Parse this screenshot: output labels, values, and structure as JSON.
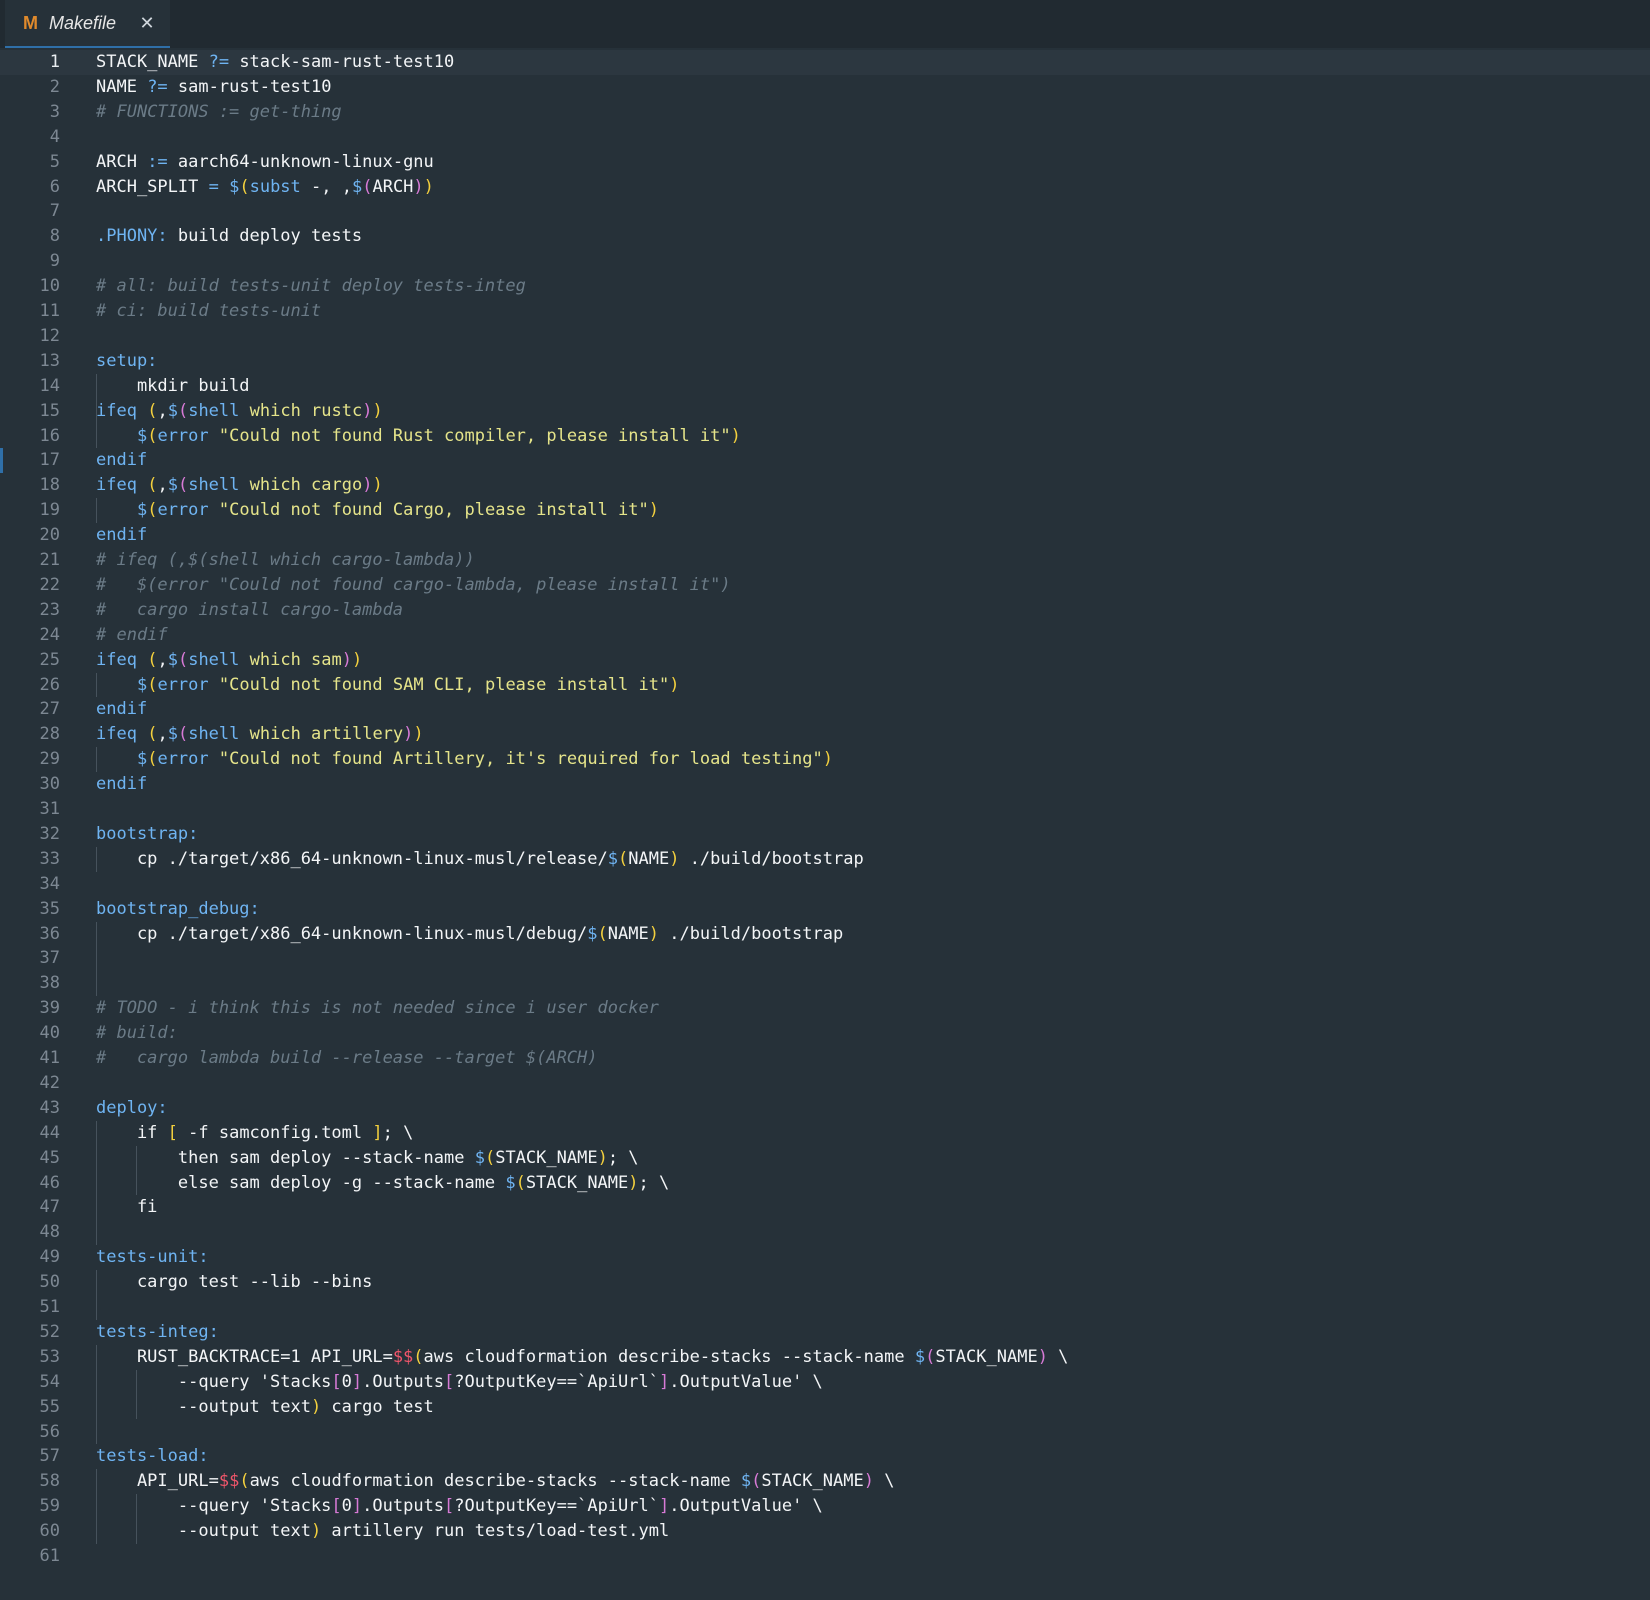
{
  "tab": {
    "icon": "M",
    "title": "Makefile",
    "close": "✕"
  },
  "current_line": 1,
  "lines": [
    [
      [
        "w",
        "STACK_NAME "
      ],
      [
        "k",
        "?="
      ],
      [
        "w",
        " stack-sam-rust-test10"
      ]
    ],
    [
      [
        "w",
        "NAME "
      ],
      [
        "k",
        "?="
      ],
      [
        "w",
        " sam-rust-test10"
      ]
    ],
    [
      [
        "c",
        "# FUNCTIONS := get-thing"
      ]
    ],
    [],
    [
      [
        "w",
        "ARCH "
      ],
      [
        "k",
        ":="
      ],
      [
        "w",
        " aarch64-unknown-linux-gnu"
      ]
    ],
    [
      [
        "w",
        "ARCH_SPLIT "
      ],
      [
        "k",
        "="
      ],
      [
        "w",
        " "
      ],
      [
        "k",
        "$"
      ],
      [
        "p1",
        "("
      ],
      [
        "f",
        "subst"
      ],
      [
        "w",
        " -, ,"
      ],
      [
        "k",
        "$"
      ],
      [
        "p2",
        "("
      ],
      [
        "w",
        "ARCH"
      ],
      [
        "p2",
        ")"
      ],
      [
        "p1",
        ")"
      ]
    ],
    [],
    [
      [
        "k",
        ".PHONY:"
      ],
      [
        "w",
        " build deploy tests"
      ]
    ],
    [],
    [
      [
        "c",
        "# all: build tests-unit deploy tests-integ"
      ]
    ],
    [
      [
        "c",
        "# ci: build tests-unit"
      ]
    ],
    [],
    [
      [
        "k",
        "setup:"
      ]
    ],
    [
      [
        "w",
        "    mkdir build"
      ]
    ],
    [
      [
        "k",
        "ifeq"
      ],
      [
        "w",
        " "
      ],
      [
        "p1",
        "("
      ],
      [
        "w",
        ","
      ],
      [
        "k",
        "$"
      ],
      [
        "p2",
        "("
      ],
      [
        "f",
        "shell"
      ],
      [
        "s",
        " which rustc"
      ],
      [
        "p2",
        ")"
      ],
      [
        "p1",
        ")"
      ]
    ],
    [
      [
        "w",
        "    "
      ],
      [
        "k",
        "$"
      ],
      [
        "p1",
        "("
      ],
      [
        "f",
        "error"
      ],
      [
        "s",
        " \"Could not found Rust compiler, please install it\""
      ],
      [
        "p1",
        ")"
      ]
    ],
    [
      [
        "k",
        "endif"
      ]
    ],
    [
      [
        "k",
        "ifeq"
      ],
      [
        "w",
        " "
      ],
      [
        "p1",
        "("
      ],
      [
        "w",
        ","
      ],
      [
        "k",
        "$"
      ],
      [
        "p2",
        "("
      ],
      [
        "f",
        "shell"
      ],
      [
        "s",
        " which cargo"
      ],
      [
        "p2",
        ")"
      ],
      [
        "p1",
        ")"
      ]
    ],
    [
      [
        "w",
        "    "
      ],
      [
        "k",
        "$"
      ],
      [
        "p1",
        "("
      ],
      [
        "f",
        "error"
      ],
      [
        "s",
        " \"Could not found Cargo, please install it\""
      ],
      [
        "p1",
        ")"
      ]
    ],
    [
      [
        "k",
        "endif"
      ]
    ],
    [
      [
        "c",
        "# ifeq (,$(shell which cargo-lambda))"
      ]
    ],
    [
      [
        "c",
        "#   $(error \"Could not found cargo-lambda, please install it\")"
      ]
    ],
    [
      [
        "c",
        "#   cargo install cargo-lambda"
      ]
    ],
    [
      [
        "c",
        "# endif"
      ]
    ],
    [
      [
        "k",
        "ifeq"
      ],
      [
        "w",
        " "
      ],
      [
        "p1",
        "("
      ],
      [
        "w",
        ","
      ],
      [
        "k",
        "$"
      ],
      [
        "p2",
        "("
      ],
      [
        "f",
        "shell"
      ],
      [
        "s",
        " which sam"
      ],
      [
        "p2",
        ")"
      ],
      [
        "p1",
        ")"
      ]
    ],
    [
      [
        "w",
        "    "
      ],
      [
        "k",
        "$"
      ],
      [
        "p1",
        "("
      ],
      [
        "f",
        "error"
      ],
      [
        "s",
        " \"Could not found SAM CLI, please install it\""
      ],
      [
        "p1",
        ")"
      ]
    ],
    [
      [
        "k",
        "endif"
      ]
    ],
    [
      [
        "k",
        "ifeq"
      ],
      [
        "w",
        " "
      ],
      [
        "p1",
        "("
      ],
      [
        "w",
        ","
      ],
      [
        "k",
        "$"
      ],
      [
        "p2",
        "("
      ],
      [
        "f",
        "shell"
      ],
      [
        "s",
        " which artillery"
      ],
      [
        "p2",
        ")"
      ],
      [
        "p1",
        ")"
      ]
    ],
    [
      [
        "w",
        "    "
      ],
      [
        "k",
        "$"
      ],
      [
        "p1",
        "("
      ],
      [
        "f",
        "error"
      ],
      [
        "s",
        " \"Could not found Artillery, it's required for load testing\""
      ],
      [
        "p1",
        ")"
      ]
    ],
    [
      [
        "k",
        "endif"
      ]
    ],
    [],
    [
      [
        "k",
        "bootstrap:"
      ]
    ],
    [
      [
        "w",
        "    cp ./target/x86_64-unknown-linux-musl/release/"
      ],
      [
        "k",
        "$"
      ],
      [
        "p1",
        "("
      ],
      [
        "w",
        "NAME"
      ],
      [
        "p1",
        ")"
      ],
      [
        "w",
        " ./build/bootstrap"
      ]
    ],
    [],
    [
      [
        "k",
        "bootstrap_debug:"
      ]
    ],
    [
      [
        "w",
        "    cp ./target/x86_64-unknown-linux-musl/debug/"
      ],
      [
        "k",
        "$"
      ],
      [
        "p1",
        "("
      ],
      [
        "w",
        "NAME"
      ],
      [
        "p1",
        ")"
      ],
      [
        "w",
        " ./build/bootstrap"
      ]
    ],
    [],
    [],
    [
      [
        "c",
        "# TODO - i think this is not needed since i user docker"
      ]
    ],
    [
      [
        "c",
        "# build:"
      ]
    ],
    [
      [
        "c",
        "#   cargo lambda build --release --target $(ARCH)"
      ]
    ],
    [],
    [
      [
        "k",
        "deploy:"
      ]
    ],
    [
      [
        "w",
        "    if "
      ],
      [
        "p1",
        "["
      ],
      [
        "w",
        " -f samconfig.toml "
      ],
      [
        "p1",
        "]"
      ],
      [
        "w",
        "; \\"
      ]
    ],
    [
      [
        "w",
        "        then sam deploy --stack-name "
      ],
      [
        "k",
        "$"
      ],
      [
        "p1",
        "("
      ],
      [
        "w",
        "STACK_NAME"
      ],
      [
        "p1",
        ")"
      ],
      [
        "w",
        "; \\"
      ]
    ],
    [
      [
        "w",
        "        else sam deploy -g --stack-name "
      ],
      [
        "k",
        "$"
      ],
      [
        "p1",
        "("
      ],
      [
        "w",
        "STACK_NAME"
      ],
      [
        "p1",
        ")"
      ],
      [
        "w",
        "; \\"
      ]
    ],
    [
      [
        "w",
        "    fi"
      ]
    ],
    [],
    [
      [
        "k",
        "tests-unit:"
      ]
    ],
    [
      [
        "w",
        "    cargo test --lib --bins"
      ]
    ],
    [],
    [
      [
        "k",
        "tests-integ:"
      ]
    ],
    [
      [
        "w",
        "    RUST_BACKTRACE=1 API_URL="
      ],
      [
        "r",
        "$$"
      ],
      [
        "p1",
        "("
      ],
      [
        "w",
        "aws cloudformation describe-stacks --stack-name "
      ],
      [
        "k",
        "$"
      ],
      [
        "p2",
        "("
      ],
      [
        "w",
        "STACK_NAME"
      ],
      [
        "p2",
        ")"
      ],
      [
        "w",
        " \\"
      ]
    ],
    [
      [
        "w",
        "        --query 'Stacks"
      ],
      [
        "p2",
        "["
      ],
      [
        "w",
        "0"
      ],
      [
        "p2",
        "]"
      ],
      [
        "w",
        ".Outputs"
      ],
      [
        "p2",
        "["
      ],
      [
        "w",
        "?OutputKey==`ApiUrl`"
      ],
      [
        "p2",
        "]"
      ],
      [
        "w",
        ".OutputValue' \\"
      ]
    ],
    [
      [
        "w",
        "        --output text"
      ],
      [
        "p1",
        ")"
      ],
      [
        "w",
        " cargo test"
      ]
    ],
    [],
    [
      [
        "k",
        "tests-load:"
      ]
    ],
    [
      [
        "w",
        "    API_URL="
      ],
      [
        "r",
        "$$"
      ],
      [
        "p1",
        "("
      ],
      [
        "w",
        "aws cloudformation describe-stacks --stack-name "
      ],
      [
        "k",
        "$"
      ],
      [
        "p2",
        "("
      ],
      [
        "w",
        "STACK_NAME"
      ],
      [
        "p2",
        ")"
      ],
      [
        "w",
        " \\"
      ]
    ],
    [
      [
        "w",
        "        --query 'Stacks"
      ],
      [
        "p2",
        "["
      ],
      [
        "w",
        "0"
      ],
      [
        "p2",
        "]"
      ],
      [
        "w",
        ".Outputs"
      ],
      [
        "p2",
        "["
      ],
      [
        "w",
        "?OutputKey==`ApiUrl`"
      ],
      [
        "p2",
        "]"
      ],
      [
        "w",
        ".OutputValue' \\"
      ]
    ],
    [
      [
        "w",
        "        --output text"
      ],
      [
        "p1",
        ")"
      ],
      [
        "w",
        " artillery run tests/load-test.yml"
      ]
    ],
    []
  ]
}
